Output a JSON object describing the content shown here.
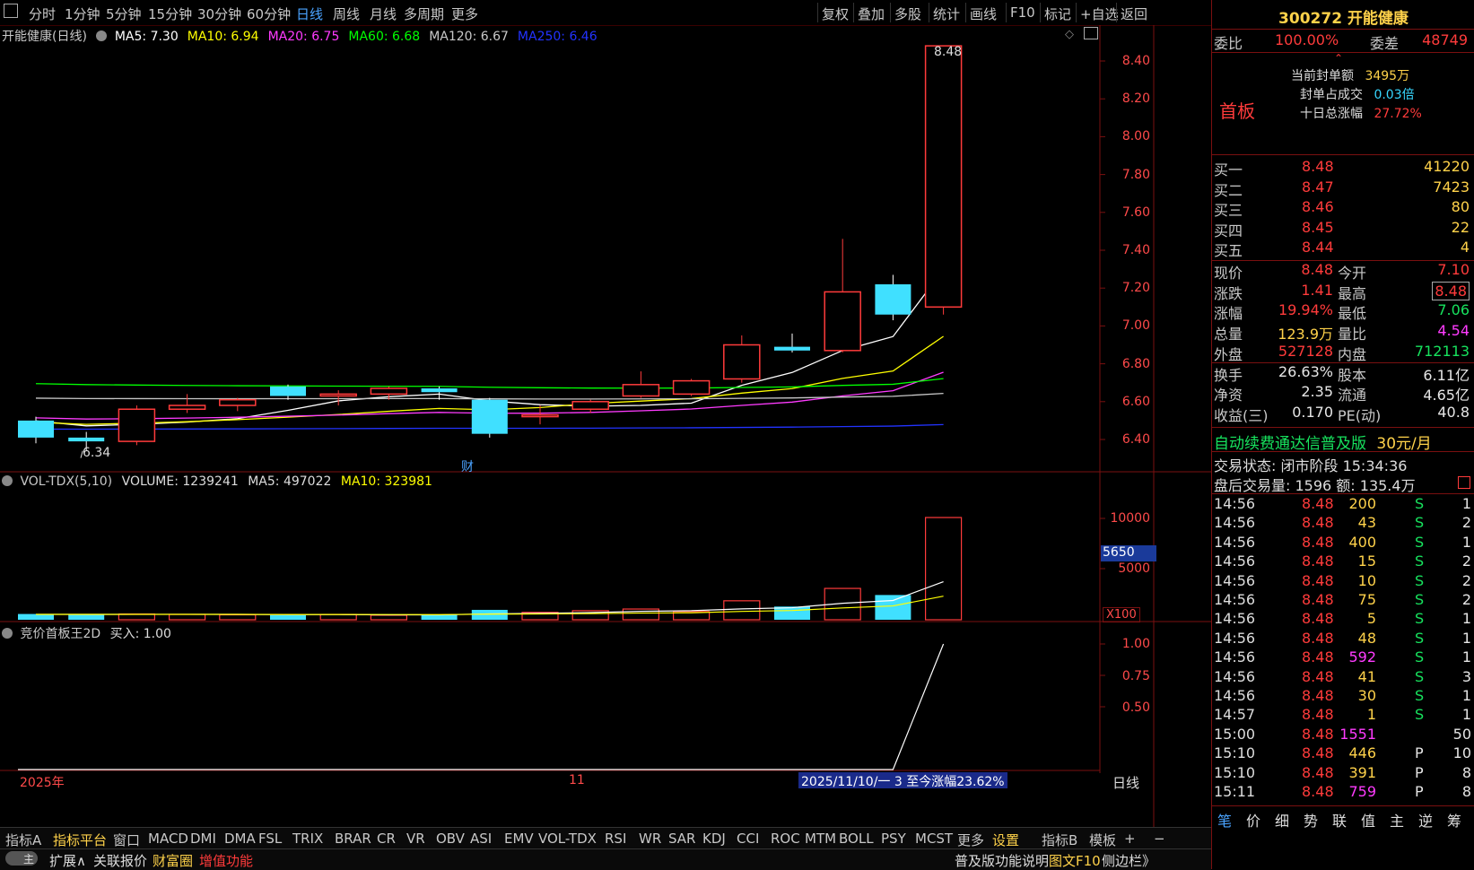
{
  "toolbar": {
    "periods": [
      "分时",
      "1分钟",
      "5分钟",
      "15分钟",
      "30分钟",
      "60分钟",
      "日线",
      "周线",
      "月线",
      "多周期",
      "更多"
    ],
    "active_period": "日线",
    "tools": [
      "复权",
      "叠加",
      "多股",
      "统计",
      "画线",
      "F10",
      "标记",
      "+自选",
      "返回"
    ]
  },
  "main_chart": {
    "title": "开能健康(日线)",
    "ma": [
      {
        "label": "MA5: 7.30",
        "color": "#ffffff"
      },
      {
        "label": "MA10: 6.94",
        "color": "#ffff00"
      },
      {
        "label": "MA20: 6.75",
        "color": "#ff3bff"
      },
      {
        "label": "MA60: 6.68",
        "color": "#00ff00"
      },
      {
        "label": "MA120: 6.67",
        "color": "#c8c8c8"
      },
      {
        "label": "MA250: 6.46",
        "color": "#2233ff"
      }
    ],
    "y_ticks": [
      "8.40",
      "8.20",
      "8.00",
      "7.80",
      "7.60",
      "7.40",
      "7.20",
      "7.00",
      "6.80",
      "6.60",
      "6.40"
    ],
    "high_label": "8.48",
    "low_label": "6.34",
    "finance_marker": "财"
  },
  "volume_panel": {
    "title": "VOL-TDX(5,10)",
    "volume": "VOLUME: 1239241",
    "ma5": "MA5: 497022",
    "ma10": "MA10: 323981",
    "y_ticks": [
      "10000",
      "5000"
    ],
    "cursor_value": "5650",
    "unit": "X100"
  },
  "indicator_panel": {
    "title": "竞价首板王2D",
    "buy": "买入: 1.00",
    "y_ticks": [
      "1.00",
      "0.75",
      "0.50"
    ]
  },
  "time_axis": {
    "year": "2025年",
    "month": "11",
    "range_note": "2025/11/10/一 3 至今涨幅23.62%",
    "period": "日线"
  },
  "indicator_tabs": [
    "指标A",
    "指标平台",
    "窗口",
    "MACD",
    "DMI",
    "DMA",
    "FSL",
    "TRIX",
    "BRAR",
    "CR",
    "VR",
    "OBV",
    "ASI",
    "EMV",
    "VOL-TDX",
    "RSI",
    "WR",
    "SAR",
    "KDJ",
    "CCI",
    "ROC",
    "MTM",
    "BOLL",
    "PSY",
    "MCST",
    "更多",
    "设置",
    "指标B",
    "模板",
    "+",
    "−"
  ],
  "bottom_bar": {
    "toggle": "主",
    "items": [
      "扩展∧",
      "关联报价",
      "财富圈",
      "增值功能"
    ],
    "right_items": [
      "普及版功能说明",
      "图文F10",
      "侧边栏》"
    ]
  },
  "quote": {
    "code_name": "300272 开能健康",
    "weibi_label": "委比",
    "weibi": "100.00%",
    "weicha_label": "委差",
    "weicha": "48749",
    "board": "首板",
    "seal_amount_label": "当前封单额",
    "seal_amount": "3495万",
    "seal_ratio_label": "封单占成交",
    "seal_ratio": "0.03倍",
    "ten_day_label": "十日总涨幅",
    "ten_day": "27.72%",
    "bids": [
      {
        "label": "买一",
        "price": "8.48",
        "vol": "41220"
      },
      {
        "label": "买二",
        "price": "8.47",
        "vol": "7423"
      },
      {
        "label": "买三",
        "price": "8.46",
        "vol": "80"
      },
      {
        "label": "买四",
        "price": "8.45",
        "vol": "22"
      },
      {
        "label": "买五",
        "price": "8.44",
        "vol": "4"
      }
    ],
    "stats": [
      {
        "l1": "现价",
        "v1": "8.48",
        "l2": "今开",
        "v2": "7.10"
      },
      {
        "l1": "涨跌",
        "v1": "1.41",
        "l2": "最高",
        "v2": "8.48"
      },
      {
        "l1": "涨幅",
        "v1": "19.94%",
        "l2": "最低",
        "v2": "7.06"
      },
      {
        "l1": "总量",
        "v1": "123.9万",
        "l2": "量比",
        "v2": "4.54"
      },
      {
        "l1": "外盘",
        "v1": "527128",
        "l2": "内盘",
        "v2": "712113"
      },
      {
        "l1": "换手",
        "v1": "26.63%",
        "l2": "股本",
        "v2": "6.11亿"
      },
      {
        "l1": "净资",
        "v1": "2.35",
        "l2": "流通",
        "v2": "4.65亿"
      },
      {
        "l1": "收益(三)",
        "v1": "0.170",
        "l2": "PE(动)",
        "v2": "40.8"
      }
    ],
    "promo": "自动续费通达信普及版",
    "promo_price": "30元/月",
    "status": "交易状态: 闭市阶段 15:34:36",
    "after_hours": "盘后交易量: 1596  额: 135.4万",
    "trades": [
      {
        "t": "14:56",
        "p": "8.48",
        "v": "200",
        "s": "S",
        "n": "1"
      },
      {
        "t": "14:56",
        "p": "8.48",
        "v": "43",
        "s": "S",
        "n": "2"
      },
      {
        "t": "14:56",
        "p": "8.48",
        "v": "400",
        "s": "S",
        "n": "1"
      },
      {
        "t": "14:56",
        "p": "8.48",
        "v": "15",
        "s": "S",
        "n": "2"
      },
      {
        "t": "14:56",
        "p": "8.48",
        "v": "10",
        "s": "S",
        "n": "2"
      },
      {
        "t": "14:56",
        "p": "8.48",
        "v": "75",
        "s": "S",
        "n": "2"
      },
      {
        "t": "14:56",
        "p": "8.48",
        "v": "5",
        "s": "S",
        "n": "1"
      },
      {
        "t": "14:56",
        "p": "8.48",
        "v": "48",
        "s": "S",
        "n": "1"
      },
      {
        "t": "14:56",
        "p": "8.48",
        "v": "592",
        "s": "S",
        "n": "1"
      },
      {
        "t": "14:56",
        "p": "8.48",
        "v": "41",
        "s": "S",
        "n": "3"
      },
      {
        "t": "14:56",
        "p": "8.48",
        "v": "30",
        "s": "S",
        "n": "1"
      },
      {
        "t": "14:57",
        "p": "8.48",
        "v": "1",
        "s": "S",
        "n": "1"
      },
      {
        "t": "15:00",
        "p": "8.48",
        "v": "1551",
        "s": "",
        "n": "50"
      },
      {
        "t": "15:10",
        "p": "8.48",
        "v": "446",
        "s": "P",
        "n": "10"
      },
      {
        "t": "15:10",
        "p": "8.48",
        "v": "391",
        "s": "P",
        "n": "8"
      },
      {
        "t": "15:11",
        "p": "8.48",
        "v": "759",
        "s": "P",
        "n": "8"
      }
    ],
    "side_tabs": [
      "笔",
      "价",
      "细",
      "势",
      "联",
      "值",
      "主",
      "逆",
      "筹"
    ]
  },
  "candles": [
    {
      "o": 6.5,
      "h": 6.52,
      "l": 6.38,
      "c": 6.41,
      "v": 700
    },
    {
      "o": 6.41,
      "h": 6.44,
      "l": 6.34,
      "c": 6.39,
      "v": 600
    },
    {
      "o": 6.39,
      "h": 6.58,
      "l": 6.37,
      "c": 6.56,
      "v": 700
    },
    {
      "o": 6.56,
      "h": 6.64,
      "l": 6.54,
      "c": 6.58,
      "v": 650
    },
    {
      "o": 6.58,
      "h": 6.62,
      "l": 6.55,
      "c": 6.61,
      "v": 600
    },
    {
      "o": 6.68,
      "h": 6.69,
      "l": 6.61,
      "c": 6.63,
      "v": 550
    },
    {
      "o": 6.63,
      "h": 6.66,
      "l": 6.58,
      "c": 6.64,
      "v": 650
    },
    {
      "o": 6.64,
      "h": 6.68,
      "l": 6.61,
      "c": 6.67,
      "v": 550
    },
    {
      "o": 6.67,
      "h": 6.68,
      "l": 6.61,
      "c": 6.65,
      "v": 600
    },
    {
      "o": 6.61,
      "h": 6.62,
      "l": 6.41,
      "c": 6.43,
      "v": 1200
    },
    {
      "o": 6.53,
      "h": 6.58,
      "l": 6.48,
      "c": 6.53,
      "v": 900
    },
    {
      "o": 6.56,
      "h": 6.61,
      "l": 6.54,
      "c": 6.6,
      "v": 1100
    },
    {
      "o": 6.63,
      "h": 6.76,
      "l": 6.62,
      "c": 6.69,
      "v": 1300
    },
    {
      "o": 6.64,
      "h": 6.72,
      "l": 6.63,
      "c": 6.71,
      "v": 1000
    },
    {
      "o": 6.72,
      "h": 6.95,
      "l": 6.7,
      "c": 6.9,
      "v": 2300
    },
    {
      "o": 6.89,
      "h": 6.96,
      "l": 6.86,
      "c": 6.87,
      "v": 1600
    },
    {
      "o": 6.87,
      "h": 7.46,
      "l": 6.86,
      "c": 7.18,
      "v": 3800
    },
    {
      "o": 7.22,
      "h": 7.27,
      "l": 7.03,
      "c": 7.06,
      "v": 3000
    },
    {
      "o": 7.1,
      "h": 8.48,
      "l": 7.06,
      "c": 8.48,
      "v": 12392
    }
  ],
  "colors": {
    "up": "#ff3b3b",
    "down": "#40e0ff",
    "grid": "#7a1010",
    "accent": "#4aa3ff"
  }
}
